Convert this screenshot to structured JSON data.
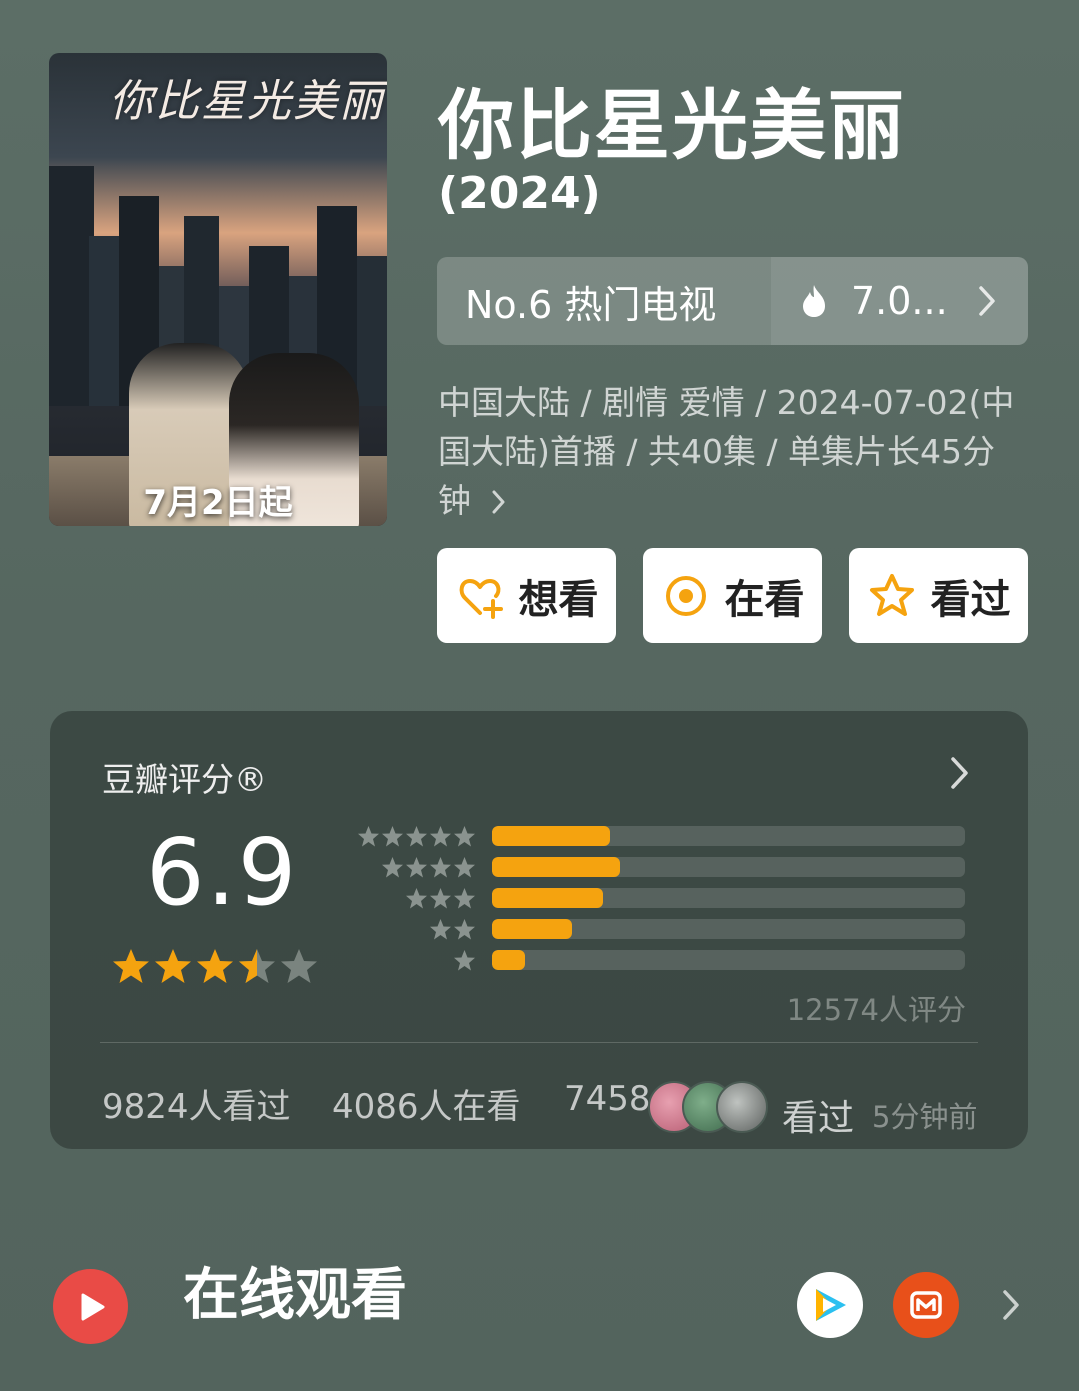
{
  "poster": {
    "title_art": "你比星光美丽",
    "date_text": "7月2日起"
  },
  "header": {
    "title": "你比星光美丽",
    "year": "(2024)"
  },
  "rank": {
    "label": "No.6 热门电视",
    "heat": "7.0..."
  },
  "meta": {
    "text": "中国大陆 / 剧情 爱情 / 2024-07-02(中国大陆)首播 / 共40集 / 单集片长45分钟"
  },
  "actions": {
    "want": "想看",
    "watching": "在看",
    "watched": "看过"
  },
  "rating": {
    "title": "豆瓣评分®",
    "score": "6.9",
    "stars_value": 3.5,
    "distribution_fraction": [
      0.25,
      0.27,
      0.235,
      0.17,
      0.07
    ],
    "votes": "12574人评分",
    "watched_count": "9824人看过",
    "watching_count": "4086人在看",
    "want_count_partial": "7458",
    "recent_label": "看过",
    "recent_time": "5分钟前"
  },
  "colors": {
    "accent": "#f5a30f",
    "play": "#e94b46",
    "mango": "#e8501a"
  },
  "online": {
    "title": "在线观看"
  }
}
